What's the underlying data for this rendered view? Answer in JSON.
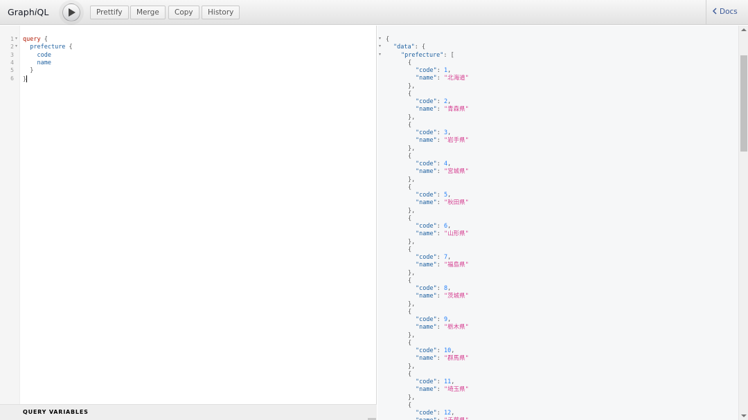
{
  "header": {
    "logo_text_pre": "Graph",
    "logo_text_i": "i",
    "logo_text_post": "QL",
    "execute_icon": "play-icon",
    "buttons": [
      "Prettify",
      "Merge",
      "Copy",
      "History"
    ],
    "docs_label": "Docs",
    "docs_icon": "chevron-left-icon"
  },
  "query_editor": {
    "line_numbers": [
      "1",
      "2",
      "3",
      "4",
      "5",
      "6"
    ],
    "lines": [
      {
        "keyword": "query",
        "field": "",
        "punct": " {"
      },
      {
        "keyword": "",
        "field": "prefecture",
        "punct": " {"
      },
      {
        "keyword": "",
        "field": "code",
        "punct": ""
      },
      {
        "keyword": "",
        "field": "name",
        "punct": ""
      },
      {
        "keyword": "",
        "field": "",
        "punct": "}"
      },
      {
        "keyword": "",
        "field": "",
        "punct": "}"
      }
    ],
    "variables_label": "QUERY VARIABLES"
  },
  "result": {
    "open_brace": "{",
    "data_key": "\"data\"",
    "prefecture_key": "\"prefecture\"",
    "code_key": "\"code\"",
    "name_key": "\"name\"",
    "items": [
      {
        "code": "1",
        "name": "\"北海道\""
      },
      {
        "code": "2",
        "name": "\"青森県\""
      },
      {
        "code": "3",
        "name": "\"岩手県\""
      },
      {
        "code": "4",
        "name": "\"宮城県\""
      },
      {
        "code": "5",
        "name": "\"秋田県\""
      },
      {
        "code": "6",
        "name": "\"山形県\""
      },
      {
        "code": "7",
        "name": "\"福島県\""
      },
      {
        "code": "8",
        "name": "\"茨城県\""
      },
      {
        "code": "9",
        "name": "\"栃木県\""
      },
      {
        "code": "10",
        "name": "\"群馬県\""
      },
      {
        "code": "11",
        "name": "\"埼玉県\""
      },
      {
        "code": "12",
        "name": "\"千葉県\""
      }
    ]
  },
  "colors": {
    "keyword": "#b11a04",
    "field": "#1f61a0",
    "number": "#2882f9",
    "string": "#d64292",
    "docs_link": "#3b5998"
  }
}
